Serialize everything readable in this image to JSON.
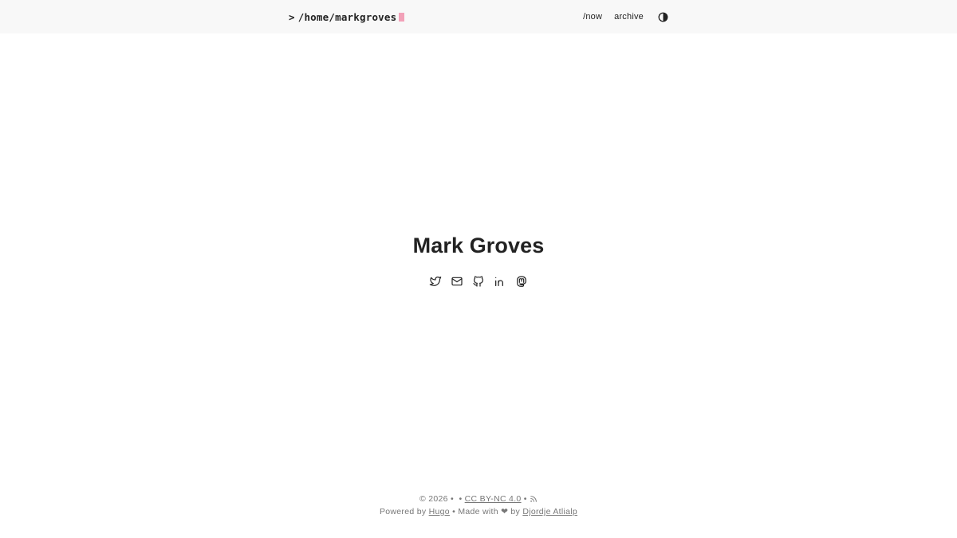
{
  "header": {
    "prompt": ">",
    "path": "/home/markgroves",
    "nav": [
      {
        "label": "/now"
      },
      {
        "label": "archive"
      }
    ],
    "cursor_color": "#f2a1b8"
  },
  "main": {
    "name": "Mark Groves",
    "social_icons": [
      "twitter-icon",
      "mail-icon",
      "github-icon",
      "linkedin-icon",
      "mastodon-icon"
    ]
  },
  "footer": {
    "copyright": "© 2026 •",
    "separator": "•",
    "license_label": "CC BY-NC 4.0",
    "rss_separator": "•",
    "powered_by": "Powered by",
    "hugo_label": "Hugo",
    "made_with": "• Made with ❤ by",
    "author_label": "Djordje Atlialp"
  }
}
